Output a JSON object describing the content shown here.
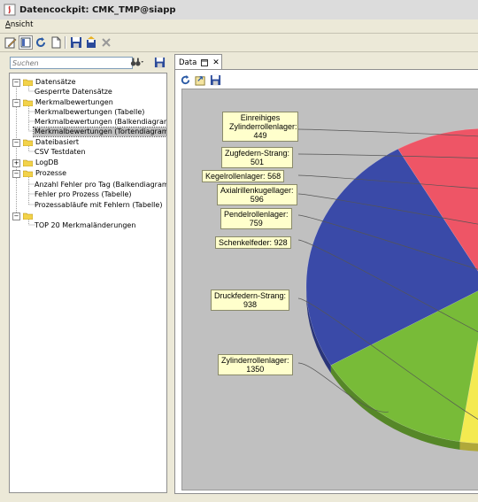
{
  "window": {
    "title": "Datencockpit: CMK_TMP@siapp"
  },
  "menu": {
    "items": [
      "Ansicht"
    ]
  },
  "search": {
    "placeholder": "Suchen"
  },
  "tree": {
    "items": [
      {
        "label": "Datensätze",
        "level": 0,
        "folder": true,
        "expanded": true
      },
      {
        "label": "Gesperrte Datensätze",
        "level": 1,
        "folder": false
      },
      {
        "label": "Merkmalbewertungen",
        "level": 0,
        "folder": true,
        "expanded": true
      },
      {
        "label": "Merkmalbewertungen (Tabelle)",
        "level": 1,
        "folder": false
      },
      {
        "label": "Merkmalbewertungen (Balkendiagramm)",
        "level": 1,
        "folder": false
      },
      {
        "label": "Merkmalbewertungen (Tortendiagramm)",
        "level": 1,
        "folder": false,
        "selected": true
      },
      {
        "label": "Dateibasiert",
        "level": 0,
        "folder": true,
        "expanded": true
      },
      {
        "label": "CSV Testdaten",
        "level": 1,
        "folder": false
      },
      {
        "label": "LogDB",
        "level": 0,
        "folder": true,
        "expanded": false
      },
      {
        "label": "Prozesse",
        "level": 0,
        "folder": true,
        "expanded": true
      },
      {
        "label": "Anzahl Fehler pro Tag (Balkendiagramm)",
        "level": 1,
        "folder": false
      },
      {
        "label": "Fehler pro Prozess (Tabelle)",
        "level": 1,
        "folder": false
      },
      {
        "label": "Prozessabläufe mit Fehlern (Tabelle)",
        "level": 1,
        "folder": false
      },
      {
        "label": "",
        "level": 0,
        "folder": true,
        "expanded": true
      },
      {
        "label": "TOP 20 Merkmaländerungen",
        "level": 1,
        "folder": false
      }
    ]
  },
  "editor": {
    "tab_label": "Data",
    "tab_close": "✕"
  },
  "chart_data": {
    "type": "pie",
    "slices": [
      {
        "label": "Einreihiges Zylinderrollenlager:",
        "value": 449,
        "color": "#2a3a9a"
      },
      {
        "label": "Zugfedern-Strang:",
        "value": 501,
        "color": "#cc1122"
      },
      {
        "label": "Kegelrollenlager:",
        "value": 568,
        "color": "#808080"
      },
      {
        "label": "Axialrillenkugellager:",
        "value": 596,
        "color": "#f4aab4"
      },
      {
        "label": "Pendelrollenlager:",
        "value": 759,
        "color": "#7ccce0"
      },
      {
        "label": "Schenkelfeder:",
        "value": 928,
        "color": "#c060b0"
      },
      {
        "label": "Druckfedern-Strang:",
        "value": 938,
        "color": "#f4ea50"
      },
      {
        "label": "Zylinderrollenlager:",
        "value": 1350,
        "color": "#78bb38"
      },
      {
        "label": "",
        "value": 2400,
        "color": "#3a4aa8"
      },
      {
        "label": "",
        "value": 1050,
        "color": "#ee5566"
      }
    ]
  },
  "colors": {
    "accent": "#316ac5",
    "chart_bg": "#c0c0c0",
    "label_bg": "#ffffcc"
  }
}
